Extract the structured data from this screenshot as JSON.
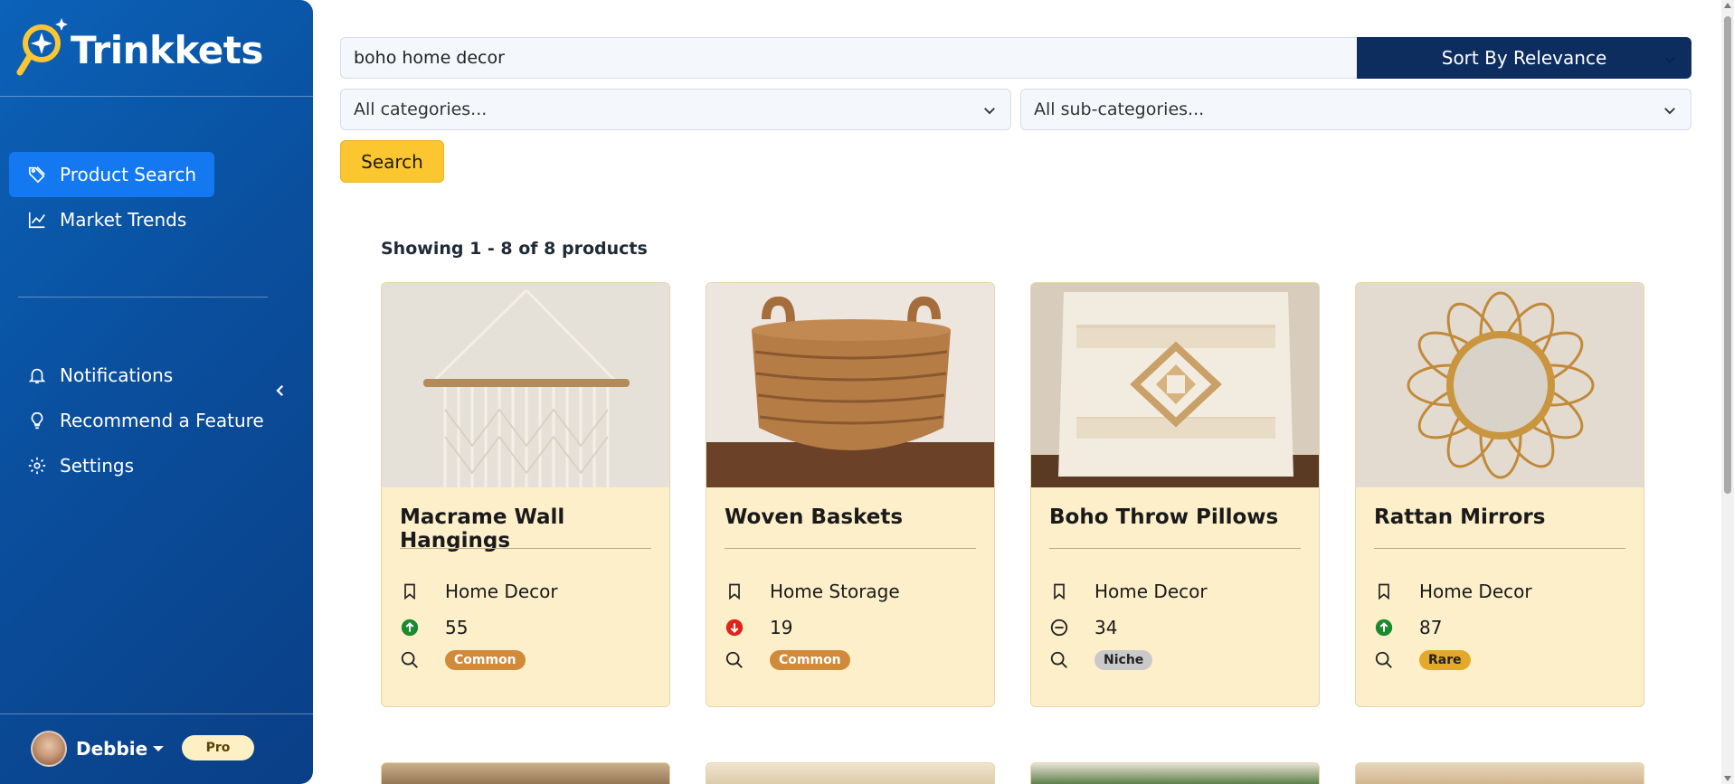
{
  "app": {
    "name": "Trinkkets"
  },
  "sidebar": {
    "items": [
      {
        "label": "Product Search",
        "icon": "tag-icon",
        "active": true
      },
      {
        "label": "Market Trends",
        "icon": "chart-line-icon",
        "active": false
      },
      {
        "label": "Notifications",
        "icon": "bell-icon",
        "active": false
      },
      {
        "label": "Recommend a Feature",
        "icon": "lightbulb-icon",
        "active": false
      },
      {
        "label": "Settings",
        "icon": "gear-icon",
        "active": false
      }
    ],
    "user": {
      "name": "Debbie",
      "plan": "Pro"
    }
  },
  "search": {
    "query": "boho home decor",
    "sort_label": "Sort By Relevance",
    "category_placeholder": "All categories...",
    "subcategory_placeholder": "All sub-categories...",
    "button_label": "Search"
  },
  "results": {
    "summary": "Showing 1 - 8 of 8 products",
    "products": [
      {
        "title": "Macrame Wall Hangings",
        "category": "Home Decor",
        "trend_value": "55",
        "trend": "up",
        "rarity": "Common"
      },
      {
        "title": "Woven Baskets",
        "category": "Home Storage",
        "trend_value": "19",
        "trend": "down",
        "rarity": "Common"
      },
      {
        "title": "Boho Throw Pillows",
        "category": "Home Decor",
        "trend_value": "34",
        "trend": "flat",
        "rarity": "Niche"
      },
      {
        "title": "Rattan Mirrors",
        "category": "Home Decor",
        "trend_value": "87",
        "trend": "up",
        "rarity": "Rare"
      }
    ]
  },
  "colors": {
    "sidebar": "#0a4f9e",
    "active_nav": "#1479f0",
    "sort_bg": "#0c2d5e",
    "search_button": "#fcc630",
    "card_bg": "#fdefc9",
    "trend_up": "#1a8a2e",
    "trend_down": "#e0241b"
  }
}
